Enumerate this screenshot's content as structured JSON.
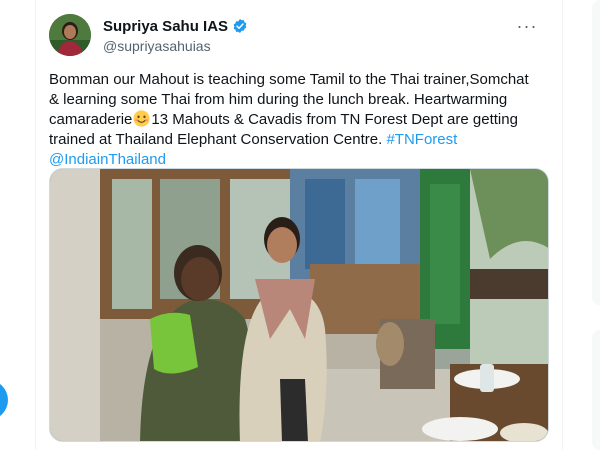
{
  "tweet": {
    "author": {
      "display_name": "Supriya Sahu IAS",
      "handle": "@supriyasahuias",
      "verified_icon": "verified-badge-icon",
      "avatar_icon": "avatar"
    },
    "more_label": "···",
    "body_lines": [
      "Bomman our Mahout is teaching some Tamil to the Thai trainer,Somchat",
      "& learning some Thai from him during the lunch break. Heartwarming",
      "camaraderie",
      "13 Mahouts & Cavadis from TN Forest Dept are getting",
      "trained at Thailand Elephant Conservation Centre.",
      "#TNForest",
      "@IndiainThailand"
    ],
    "emoji": "smiling-face-emoji",
    "media": {
      "kind": "photo",
      "description_icon": "tweet-photo"
    }
  },
  "colors": {
    "accent": "#1d9bf0",
    "text": "#0f1419",
    "secondary": "#536471",
    "border": "#cfd9de"
  }
}
